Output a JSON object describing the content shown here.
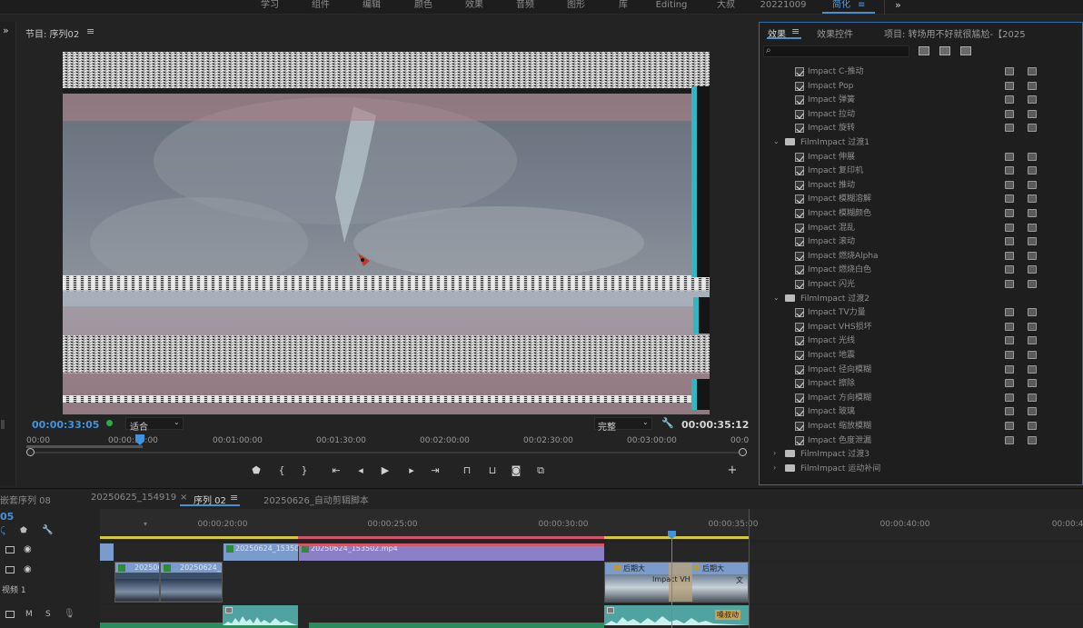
{
  "workspaces": [
    "学习",
    "组件",
    "编辑",
    "颜色",
    "效果",
    "音频",
    "图形",
    "库",
    "Editing",
    "大叔",
    "20221009",
    "简化"
  ],
  "workspace_active_index": 11,
  "program": {
    "title": "节目: 序列02",
    "menu_icon": "hamburger-icon",
    "timecode_current": "00:00:33:05",
    "fit_label": "适合",
    "quality_label": "完整",
    "timecode_duration": "00:00:35:12",
    "ruler_labels": [
      "00:00",
      "00:00:30:00",
      "00:01:00:00",
      "00:01:30:00",
      "00:02:00:00",
      "00:02:30:00",
      "00:03:00:00",
      "00:0"
    ]
  },
  "effects_panel": {
    "tab_effects": "效果",
    "tab_effect_controls": "效果控件",
    "tab_project": "项目: 转场用不好就很尴尬-【2025",
    "search_placeholder": "",
    "items": [
      {
        "type": "effect",
        "label": "Impact C-推动"
      },
      {
        "type": "effect",
        "label": "Impact Pop"
      },
      {
        "type": "effect",
        "label": "Impact 弹簧"
      },
      {
        "type": "effect",
        "label": "Impact 拉动"
      },
      {
        "type": "effect",
        "label": "Impact 旋转"
      },
      {
        "type": "folder",
        "label": "FilmImpact 过渡1"
      },
      {
        "type": "effect",
        "label": "Impact 伸展"
      },
      {
        "type": "effect",
        "label": "Impact 复印机"
      },
      {
        "type": "effect",
        "label": "Impact 推动"
      },
      {
        "type": "effect",
        "label": "Impact 模糊溶解"
      },
      {
        "type": "effect",
        "label": "Impact 模糊颜色"
      },
      {
        "type": "effect",
        "label": "Impact 混乱"
      },
      {
        "type": "effect",
        "label": "Impact 滚动"
      },
      {
        "type": "effect",
        "label": "Impact 燃烧Alpha"
      },
      {
        "type": "effect",
        "label": "Impact 燃烧白色"
      },
      {
        "type": "effect",
        "label": "Impact 闪光"
      },
      {
        "type": "folder",
        "label": "FilmImpact 过渡2"
      },
      {
        "type": "effect",
        "label": "Impact TV力量"
      },
      {
        "type": "effect",
        "label": "Impact VHS损坏"
      },
      {
        "type": "effect",
        "label": "Impact 光线"
      },
      {
        "type": "effect",
        "label": "Impact 地震"
      },
      {
        "type": "effect",
        "label": "Impact 径向模糊"
      },
      {
        "type": "effect",
        "label": "Impact 擦除"
      },
      {
        "type": "effect",
        "label": "Impact 方向模糊"
      },
      {
        "type": "effect",
        "label": "Impact 玻璃"
      },
      {
        "type": "effect",
        "label": "Impact 缩放模糊"
      },
      {
        "type": "effect",
        "label": "Impact 色度泄漏"
      },
      {
        "type": "folder-collapsed",
        "label": "FilmImpact 过渡3"
      },
      {
        "type": "folder-collapsed",
        "label": "FilmImpact 运动补间"
      }
    ]
  },
  "timeline": {
    "tabs": [
      "嵌套序列 08",
      "20250625_154919",
      "序列 02",
      "20250626_自动剪辑脚本"
    ],
    "active_tab_index": 2,
    "close_icon": "×",
    "timecode": "05",
    "ruler_labels": [
      "00:00:20:00",
      "00:00:25:00",
      "00:00:30:00",
      "00:00:35:00",
      "00:00:40:00",
      "00:00:45"
    ],
    "track_v_label": "视频 1",
    "track_m": "M",
    "track_s": "S",
    "clips": {
      "v2_a": "20250624_153502",
      "v2_b": "20250624_153502.mp4",
      "v1_a": "2025062",
      "v1_b": "20250624_153",
      "v1_fx1": "后期大",
      "v1_fx2": "后期大",
      "v1_fx3": "Impact VH",
      "v1_fx4": "文",
      "a1_label": "嗓叔动"
    }
  },
  "colors": {
    "accent": "#4b8fd1",
    "timecode": "#3f94e0",
    "clip_blue": "#7b9bcc",
    "clip_purple": "#8b7fc7",
    "audio_teal": "#4fa3a0",
    "audio_green": "#2d8a5c",
    "pink_bar": "#d2566a",
    "yellow_bar": "#d6c83a"
  }
}
